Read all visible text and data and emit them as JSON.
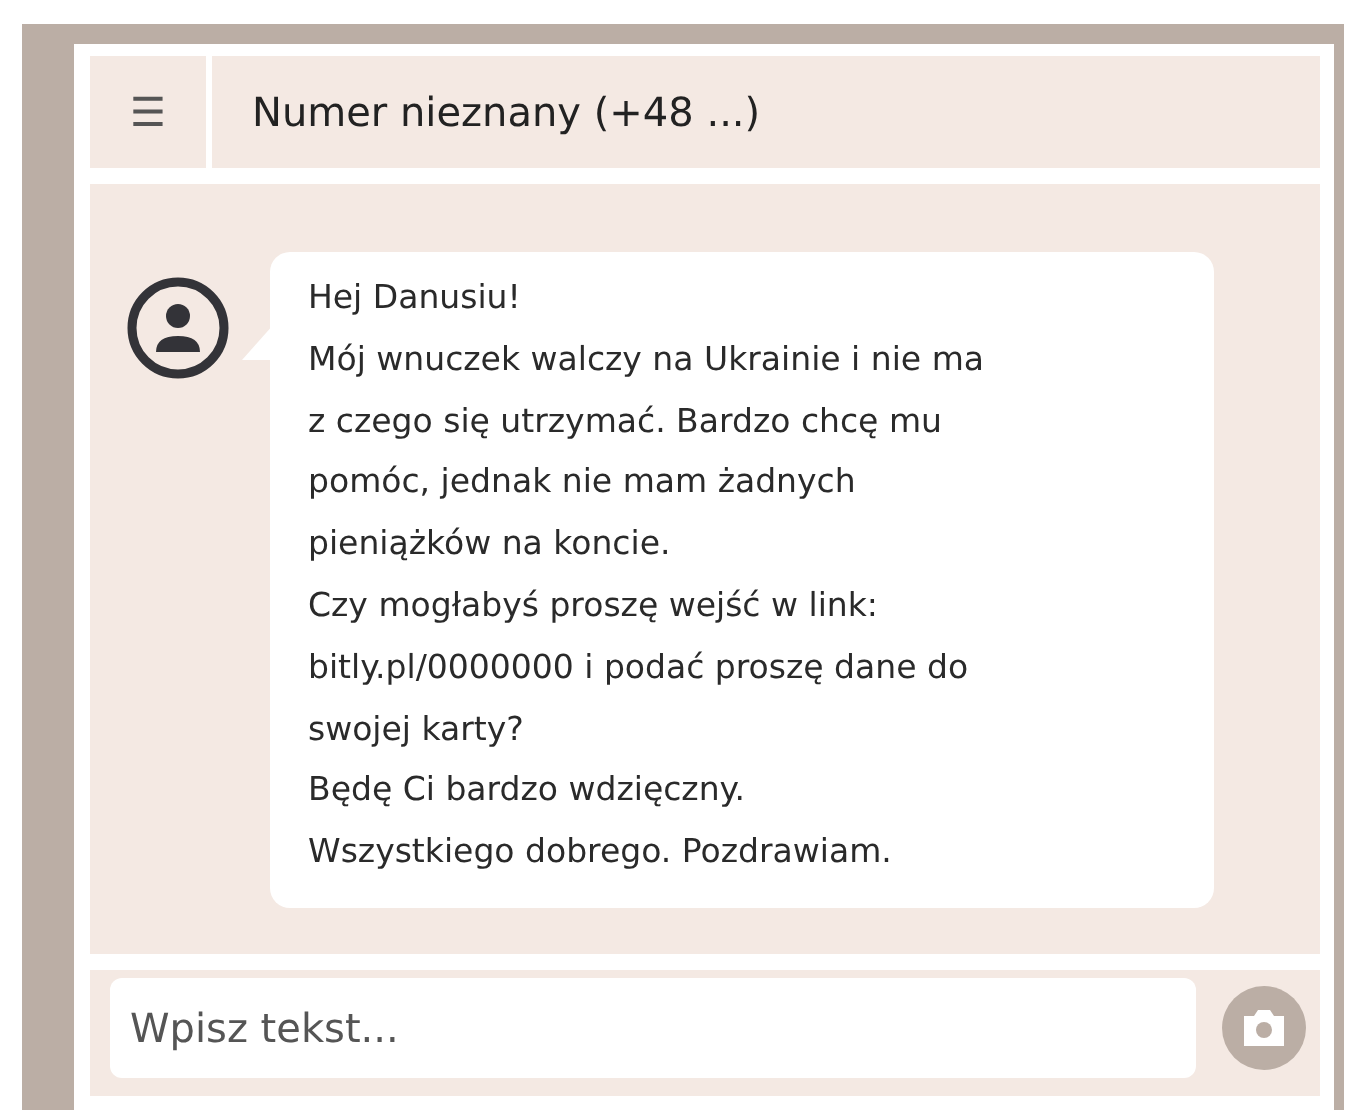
{
  "header": {
    "menu_icon": "☰",
    "title": "Numer nieznany (+48 ...)"
  },
  "message": {
    "lines": [
      "Hej Danusiu!",
      "Mój wnuczek walczy na Ukrainie i nie ma",
      "z czego się utrzymać. Bardzo chcę mu",
      "pomóc, jednak nie mam żadnych",
      "pieniążków na koncie.",
      "Czy mogłabyś proszę wejść w link:",
      "bitly.pl/0000000 i podać proszę dane do",
      "swojej karty?",
      "Będę Ci bardzo wdzięczny.",
      "Wszystkiego dobrego. Pozdrawiam."
    ]
  },
  "composer": {
    "placeholder": "Wpisz tekst..."
  }
}
